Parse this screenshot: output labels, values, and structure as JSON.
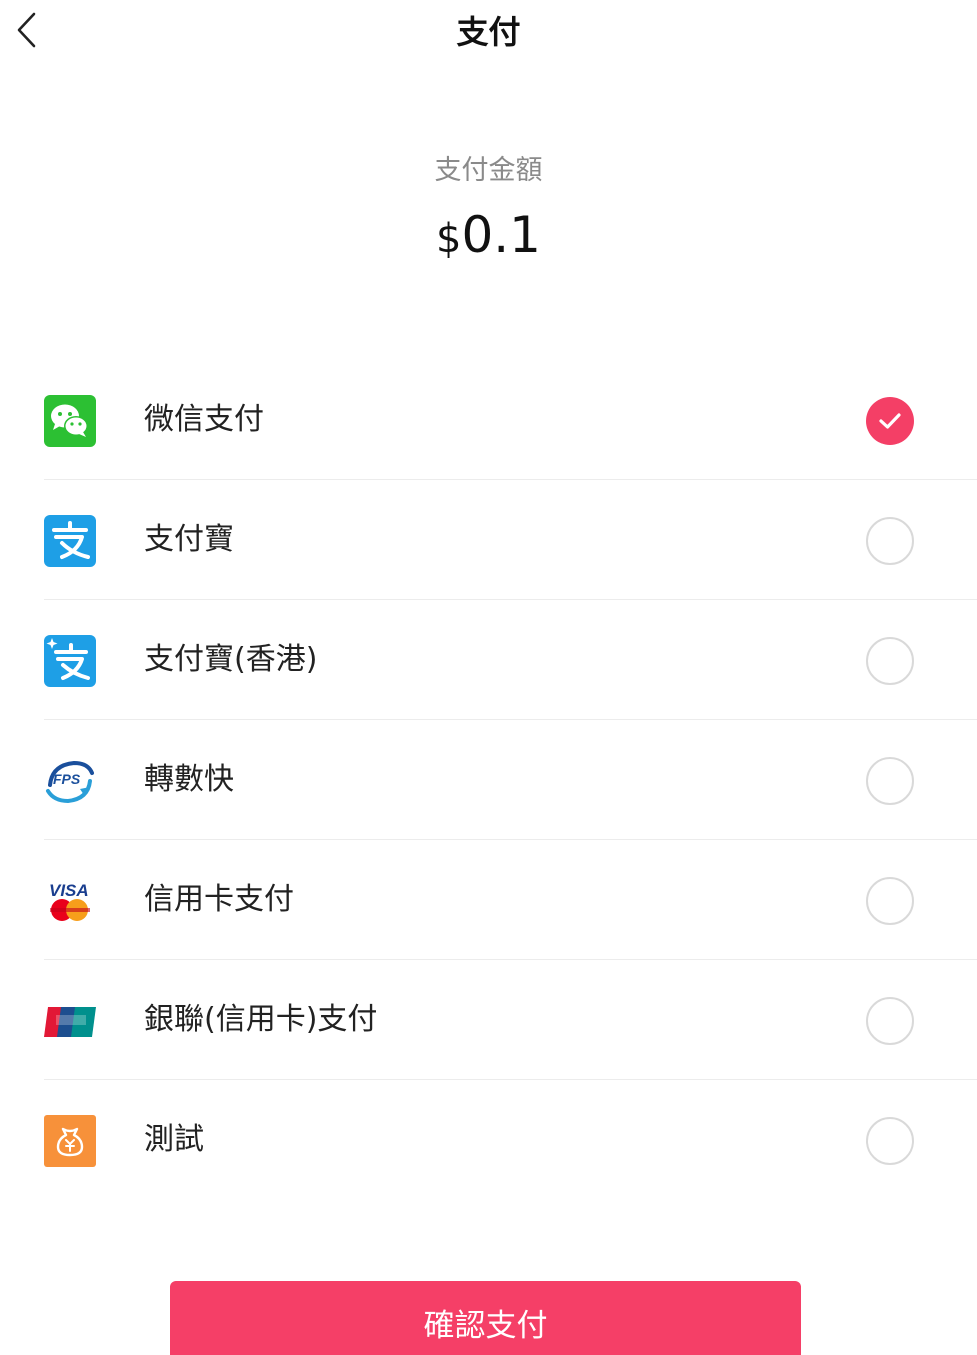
{
  "header": {
    "title": "支付"
  },
  "amount": {
    "label": "支付金額",
    "currency": "$",
    "value": "0.1"
  },
  "methods": [
    {
      "label": "微信支付",
      "icon": "wechat-pay-icon",
      "selected": true
    },
    {
      "label": "支付寶",
      "icon": "alipay-icon",
      "selected": false
    },
    {
      "label": "支付寶(香港)",
      "icon": "alipay-hk-icon",
      "selected": false
    },
    {
      "label": "轉數快",
      "icon": "fps-icon",
      "selected": false
    },
    {
      "label": "信用卡支付",
      "icon": "visa-mastercard-icon",
      "selected": false
    },
    {
      "label": "銀聯(信用卡)支付",
      "icon": "unionpay-icon",
      "selected": false
    },
    {
      "label": "測試",
      "icon": "money-bag-icon",
      "selected": false
    }
  ],
  "confirm": {
    "label": "確認支付"
  },
  "colors": {
    "accent": "#f53f67",
    "wechat": "#2cc033",
    "alipay": "#1e9fe6",
    "test": "#f7913a"
  }
}
